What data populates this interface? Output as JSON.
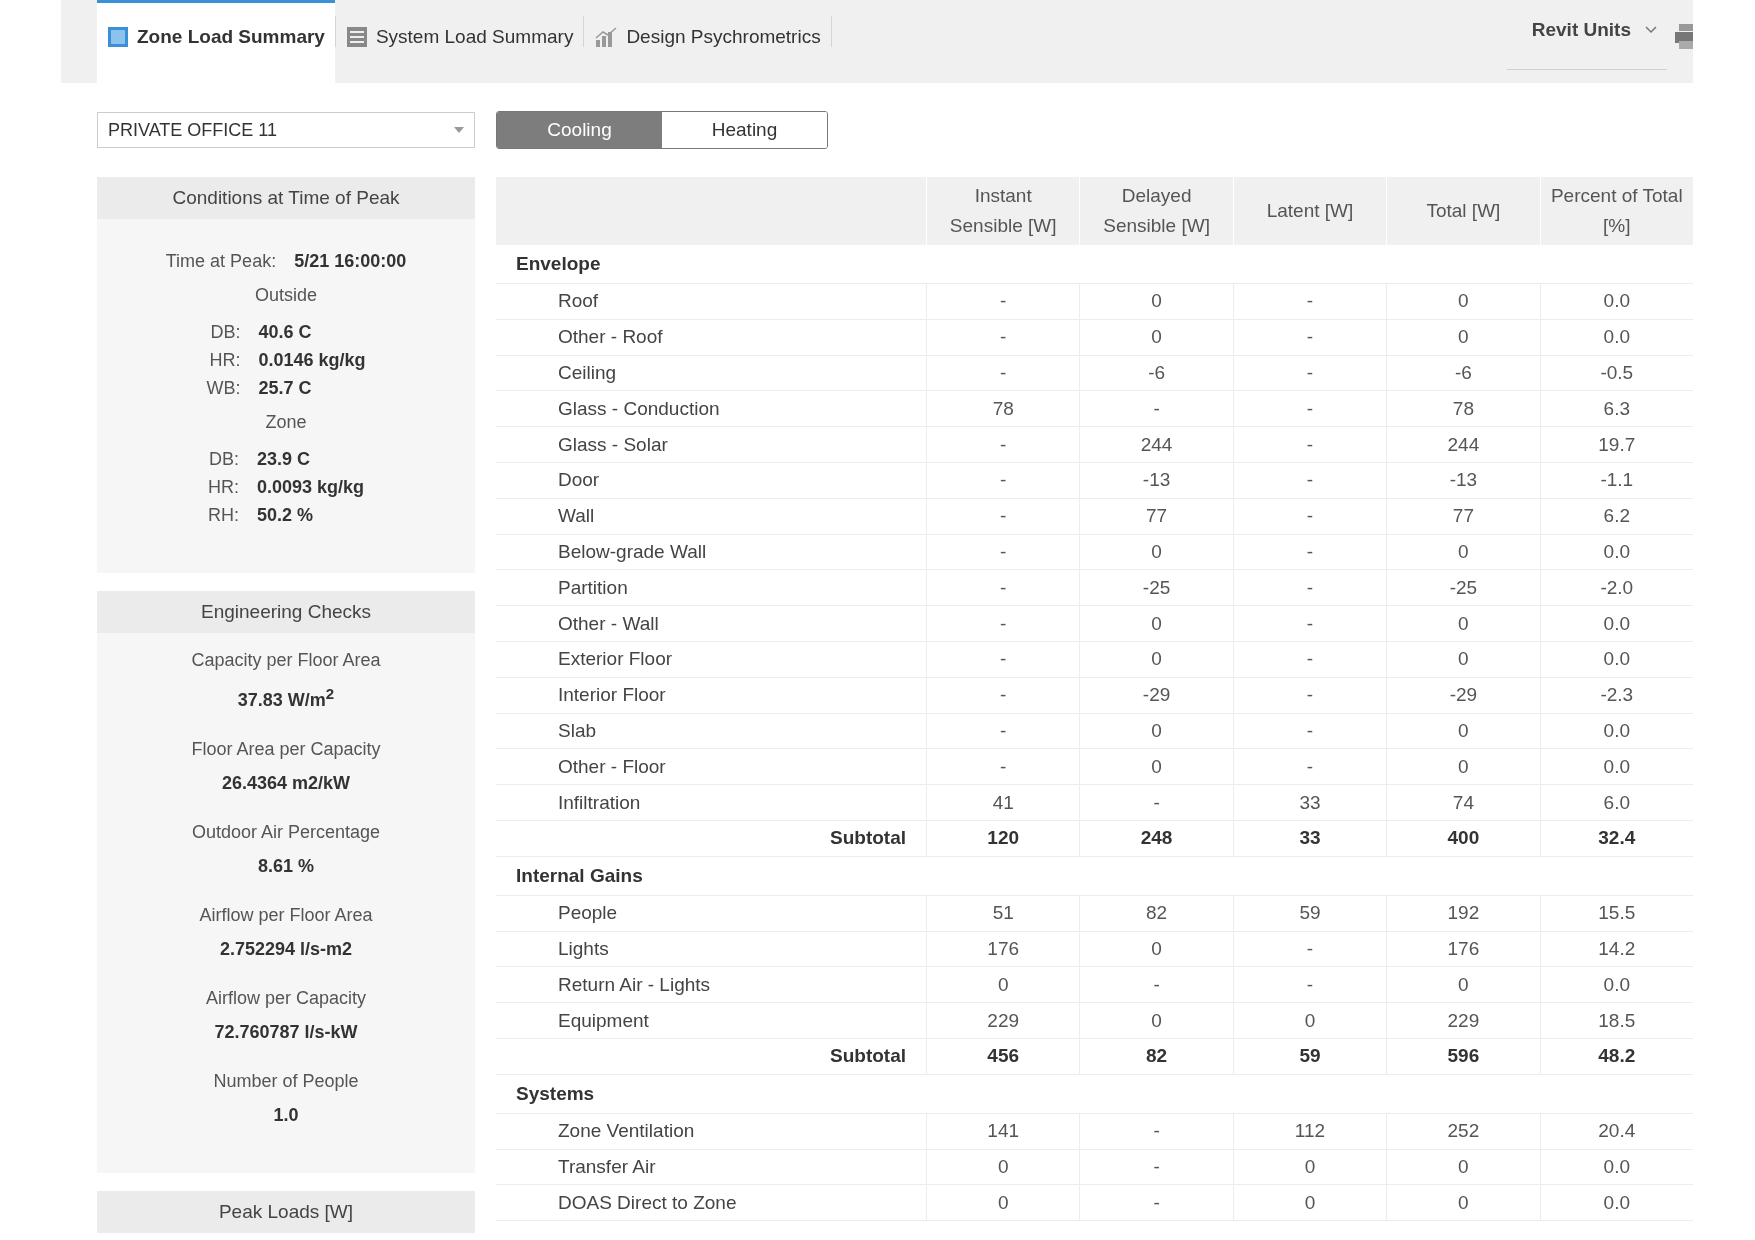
{
  "tabs": [
    {
      "label": "Zone Load Summary",
      "selected": true,
      "kind": "zone"
    },
    {
      "label": "System Load Summary",
      "selected": false,
      "kind": "system"
    },
    {
      "label": "Design Psychrometrics",
      "selected": false,
      "kind": "chart"
    }
  ],
  "units": {
    "label": "Revit Units"
  },
  "zone_select": {
    "value": "PRIVATE OFFICE 11"
  },
  "mode_toggle": [
    {
      "label": "Cooling",
      "selected": true
    },
    {
      "label": "Heating",
      "selected": false
    }
  ],
  "conditions": {
    "title": "Conditions at Time of Peak",
    "time_label": "Time at Peak:",
    "time_value": "5/21 16:00:00",
    "groups": [
      {
        "title": "Outside",
        "items": [
          {
            "label": "DB:",
            "value": "40.6 C"
          },
          {
            "label": "HR:",
            "value": "0.0146 kg/kg"
          },
          {
            "label": "WB:",
            "value": "25.7 C"
          }
        ]
      },
      {
        "title": "Zone",
        "items": [
          {
            "label": "DB:",
            "value": "23.9 C"
          },
          {
            "label": "HR:",
            "value": "0.0093 kg/kg"
          },
          {
            "label": "RH:",
            "value": "50.2 %"
          }
        ]
      }
    ]
  },
  "engineering_checks": {
    "title": "Engineering Checks",
    "items": [
      {
        "label": "Capacity per Floor Area",
        "value": "37.83 W/m$^{2}$"
      },
      {
        "label": "Floor Area per Capacity",
        "value": "26.4364 m2/kW"
      },
      {
        "label": "Outdoor Air Percentage",
        "value": "8.61 %"
      },
      {
        "label": "Airflow per Floor Area",
        "value": "2.752294 l/s-m2"
      },
      {
        "label": "Airflow per Capacity",
        "value": "72.760787 l/s-kW"
      },
      {
        "label": "Number of People",
        "value": "1.0"
      }
    ]
  },
  "peak_loads": {
    "title": "Peak Loads [W]"
  },
  "table": {
    "columns": [
      "Instant Sensible [W]",
      "Delayed Sensible [W]",
      "Latent [W]",
      "Total [W]",
      "Percent of Total [%]"
    ],
    "sections": [
      {
        "title": "Envelope",
        "rows": [
          {
            "label": "Roof",
            "cells": [
              "-",
              "0",
              "-",
              "0",
              "0.0"
            ]
          },
          {
            "label": "Other - Roof",
            "cells": [
              "-",
              "0",
              "-",
              "0",
              "0.0"
            ]
          },
          {
            "label": "Ceiling",
            "cells": [
              "-",
              "-6",
              "-",
              "-6",
              "-0.5"
            ]
          },
          {
            "label": "Glass - Conduction",
            "cells": [
              "78",
              "-",
              "-",
              "78",
              "6.3"
            ]
          },
          {
            "label": "Glass - Solar",
            "cells": [
              "-",
              "244",
              "-",
              "244",
              "19.7"
            ]
          },
          {
            "label": "Door",
            "cells": [
              "-",
              "-13",
              "-",
              "-13",
              "-1.1"
            ]
          },
          {
            "label": "Wall",
            "cells": [
              "-",
              "77",
              "-",
              "77",
              "6.2"
            ]
          },
          {
            "label": "Below-grade Wall",
            "cells": [
              "-",
              "0",
              "-",
              "0",
              "0.0"
            ]
          },
          {
            "label": "Partition",
            "cells": [
              "-",
              "-25",
              "-",
              "-25",
              "-2.0"
            ]
          },
          {
            "label": "Other - Wall",
            "cells": [
              "-",
              "0",
              "-",
              "0",
              "0.0"
            ]
          },
          {
            "label": "Exterior Floor",
            "cells": [
              "-",
              "0",
              "-",
              "0",
              "0.0"
            ]
          },
          {
            "label": "Interior Floor",
            "cells": [
              "-",
              "-29",
              "-",
              "-29",
              "-2.3"
            ]
          },
          {
            "label": "Slab",
            "cells": [
              "-",
              "0",
              "-",
              "0",
              "0.0"
            ]
          },
          {
            "label": "Other - Floor",
            "cells": [
              "-",
              "0",
              "-",
              "0",
              "0.0"
            ]
          },
          {
            "label": "Infiltration",
            "cells": [
              "41",
              "-",
              "33",
              "74",
              "6.0"
            ]
          }
        ],
        "subtotal": {
          "label": "Subtotal",
          "cells": [
            "120",
            "248",
            "33",
            "400",
            "32.4"
          ]
        }
      },
      {
        "title": "Internal Gains",
        "rows": [
          {
            "label": "People",
            "cells": [
              "51",
              "82",
              "59",
              "192",
              "15.5"
            ]
          },
          {
            "label": "Lights",
            "cells": [
              "176",
              "0",
              "-",
              "176",
              "14.2"
            ]
          },
          {
            "label": "Return Air - Lights",
            "cells": [
              "0",
              "-",
              "-",
              "0",
              "0.0"
            ]
          },
          {
            "label": "Equipment",
            "cells": [
              "229",
              "0",
              "0",
              "229",
              "18.5"
            ]
          }
        ],
        "subtotal": {
          "label": "Subtotal",
          "cells": [
            "456",
            "82",
            "59",
            "596",
            "48.2"
          ]
        }
      },
      {
        "title": "Systems",
        "rows": [
          {
            "label": "Zone Ventilation",
            "cells": [
              "141",
              "-",
              "112",
              "252",
              "20.4"
            ]
          },
          {
            "label": "Transfer Air",
            "cells": [
              "0",
              "-",
              "0",
              "0",
              "0.0"
            ]
          },
          {
            "label": "DOAS Direct to Zone",
            "cells": [
              "0",
              "-",
              "0",
              "0",
              "0.0"
            ]
          }
        ]
      }
    ]
  }
}
